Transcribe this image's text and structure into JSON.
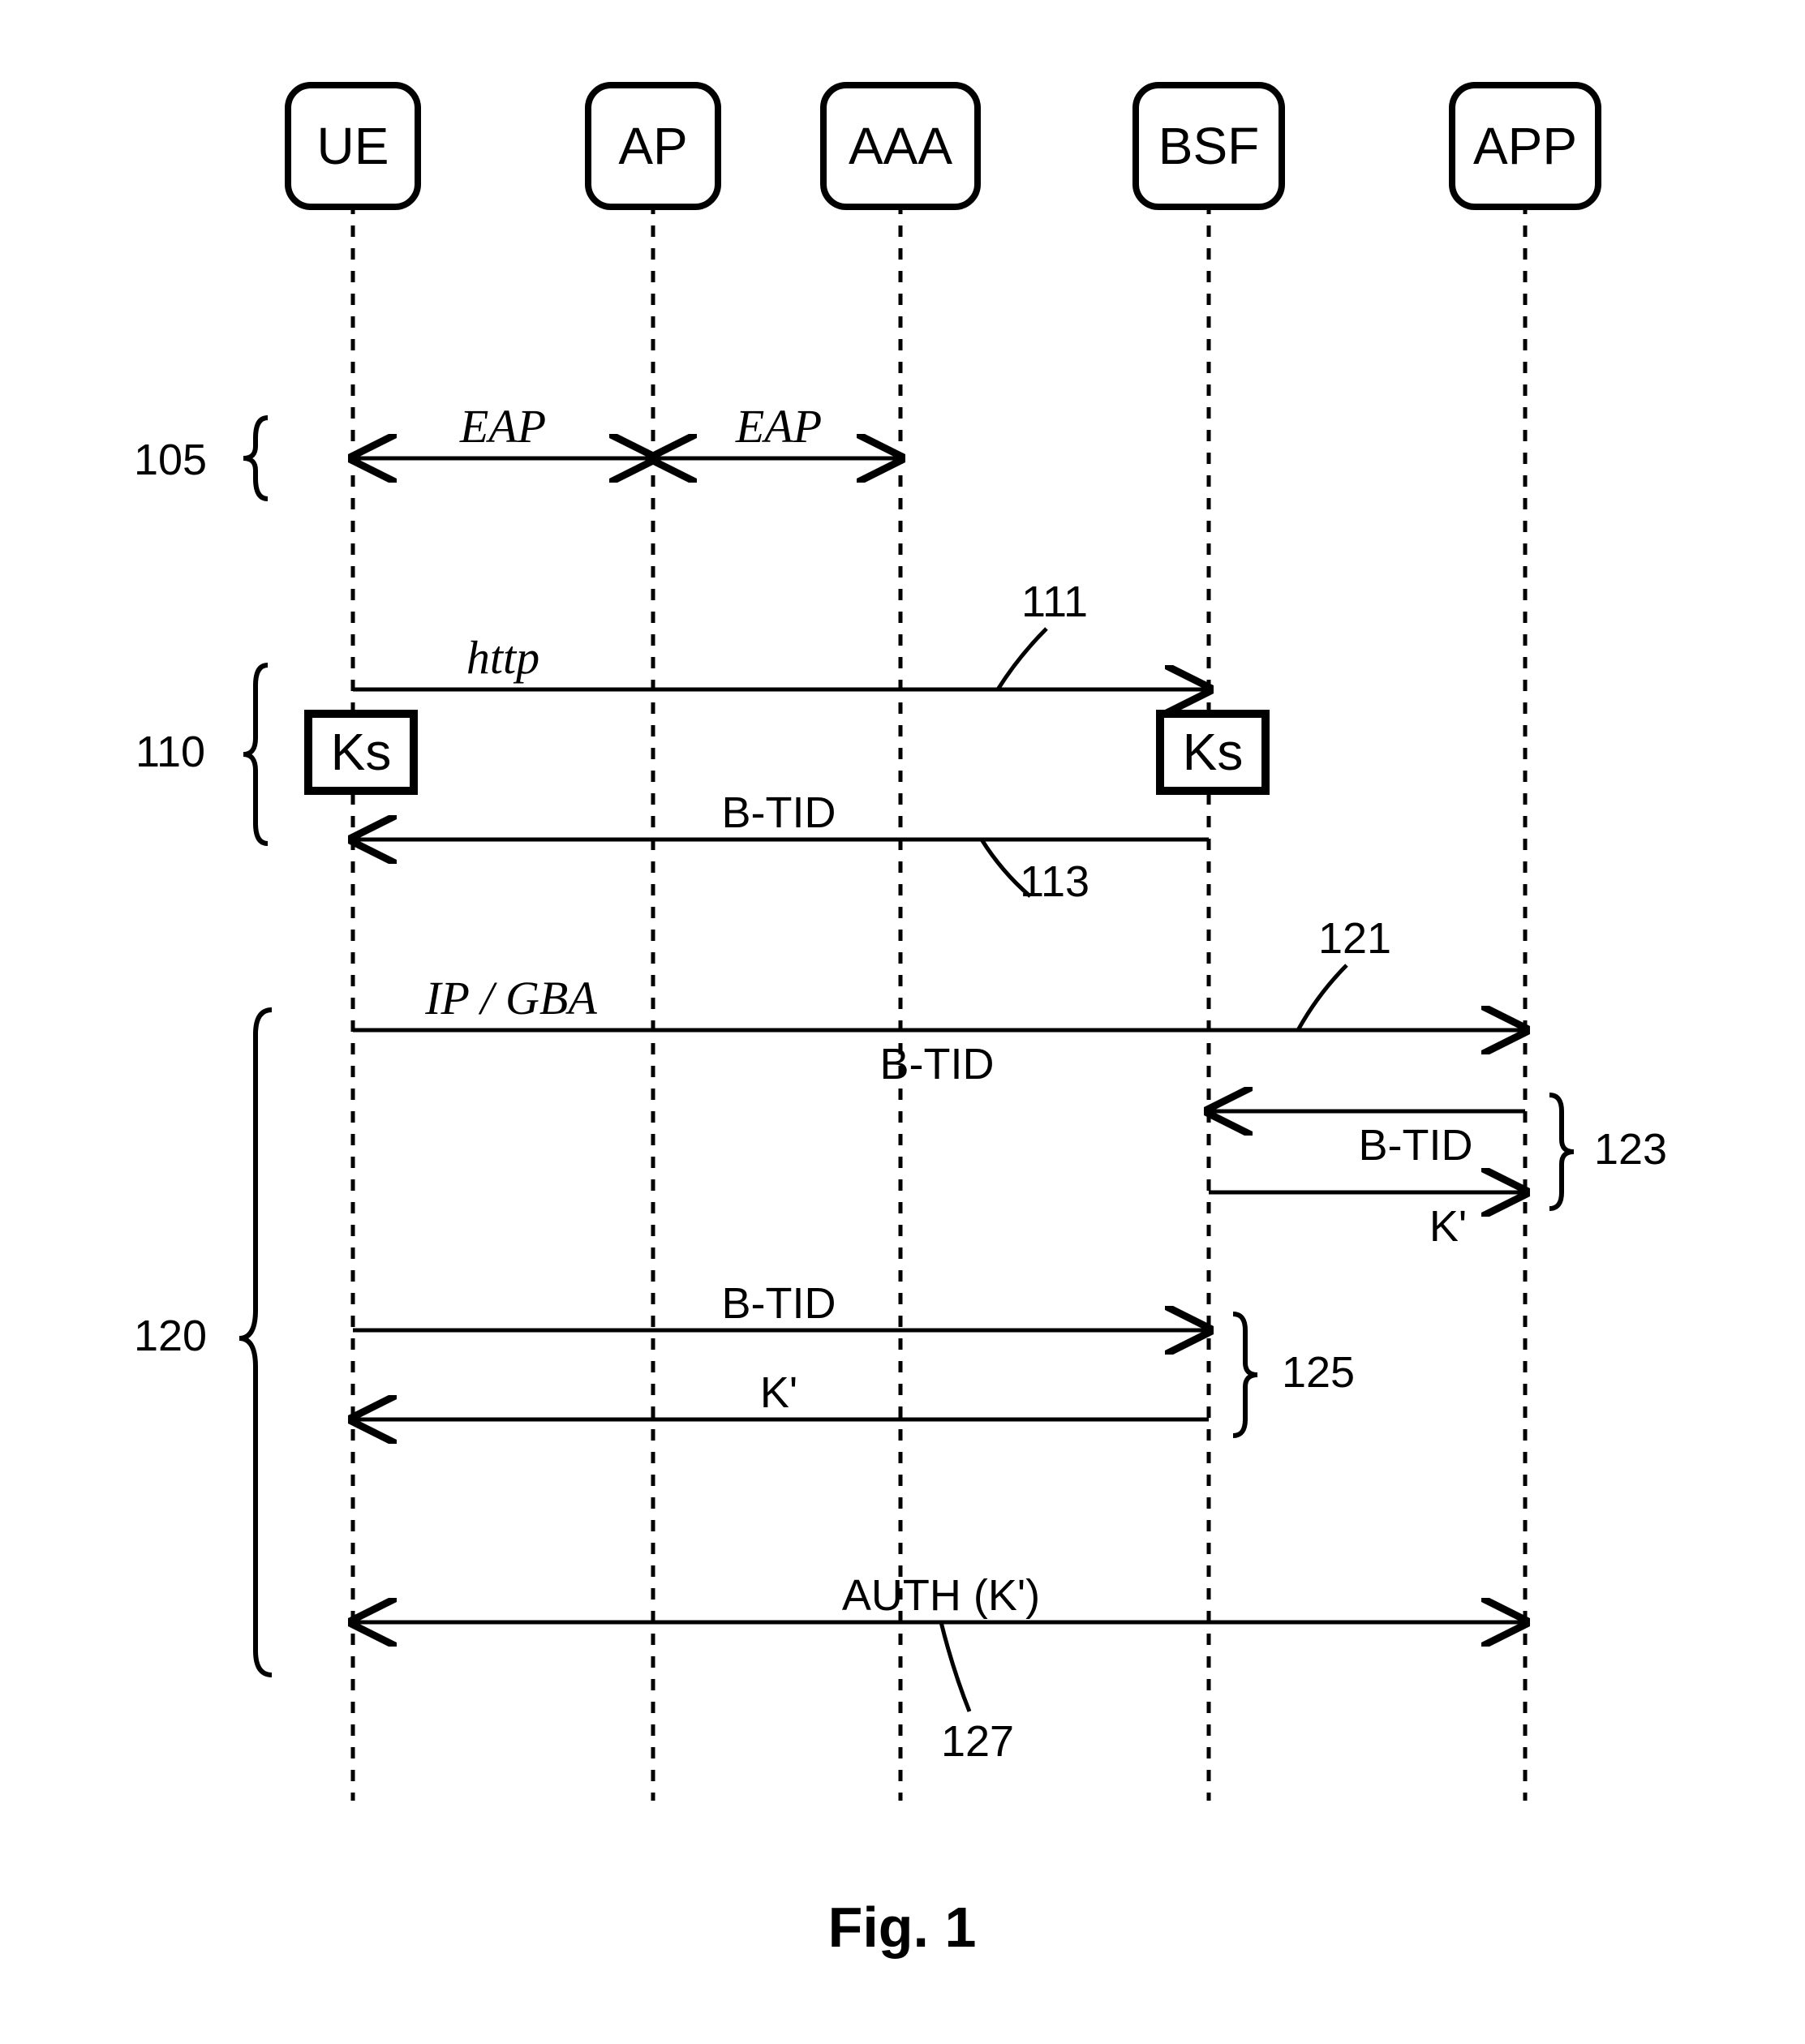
{
  "actors": {
    "ue": "UE",
    "ap": "AP",
    "aaa": "AAA",
    "bsf": "BSF",
    "app": "APP"
  },
  "groups": {
    "g105": "105",
    "g110": "110",
    "g120": "120"
  },
  "callouts": {
    "c111": "111",
    "c113": "113",
    "c121": "121",
    "c123": "123",
    "c125": "125",
    "c127": "127"
  },
  "messages": {
    "eap1": "EAP",
    "eap2": "EAP",
    "http": "http",
    "btid_110": "B-TID",
    "ipgba": "IP / GBA",
    "btid_121": "B-TID",
    "btid_123": "B-TID",
    "kprime_123": "K'",
    "btid_125": "B-TID",
    "kprime_125": "K'",
    "auth": "AUTH (K')"
  },
  "ks_label": "Ks",
  "figure": "Fig. 1",
  "chart_data": {
    "type": "sequence-diagram",
    "actors": [
      "UE",
      "AP",
      "AAA",
      "BSF",
      "APP"
    ],
    "groups": [
      {
        "id": 105,
        "span": [
          "eap_ue_ap",
          "eap_ap_aaa"
        ]
      },
      {
        "id": 110,
        "span": [
          "http_ue_bsf",
          "Ks_ue",
          "Ks_bsf",
          "btid_bsf_ue"
        ]
      },
      {
        "id": 120,
        "span": [
          "ipgba_ue_app",
          "btid_app_bsf",
          "kprime_bsf_app",
          "btid_ue_bsf_2",
          "kprime_bsf_ue_2",
          "auth_ue_app"
        ]
      }
    ],
    "interactions": [
      {
        "id": "eap_ue_ap",
        "from": "UE",
        "to": "AP",
        "label": "EAP",
        "dir": "both"
      },
      {
        "id": "eap_ap_aaa",
        "from": "AP",
        "to": "AAA",
        "label": "EAP",
        "dir": "both"
      },
      {
        "id": "http_ue_bsf",
        "from": "UE",
        "to": "BSF",
        "label": "http",
        "dir": "right",
        "callout": 111
      },
      {
        "id": "Ks_ue",
        "at": "UE",
        "type": "state",
        "label": "Ks"
      },
      {
        "id": "Ks_bsf",
        "at": "BSF",
        "type": "state",
        "label": "Ks"
      },
      {
        "id": "btid_bsf_ue",
        "from": "BSF",
        "to": "UE",
        "label": "B-TID",
        "dir": "left",
        "callout": 113
      },
      {
        "id": "ipgba_ue_app",
        "from": "UE",
        "to": "APP",
        "label": "IP / GBA / B-TID",
        "dir": "right",
        "callout": 121
      },
      {
        "id": "btid_app_bsf",
        "from": "APP",
        "to": "BSF",
        "label": "B-TID",
        "dir": "left",
        "group_callout": 123
      },
      {
        "id": "kprime_bsf_app",
        "from": "BSF",
        "to": "APP",
        "label": "K'",
        "dir": "right",
        "group_callout": 123
      },
      {
        "id": "btid_ue_bsf_2",
        "from": "UE",
        "to": "BSF",
        "label": "B-TID",
        "dir": "right",
        "group_callout": 125
      },
      {
        "id": "kprime_bsf_ue_2",
        "from": "BSF",
        "to": "UE",
        "label": "K'",
        "dir": "left",
        "group_callout": 125
      },
      {
        "id": "auth_ue_app",
        "from": "UE",
        "to": "APP",
        "label": "AUTH (K')",
        "dir": "both",
        "callout": 127
      }
    ]
  }
}
